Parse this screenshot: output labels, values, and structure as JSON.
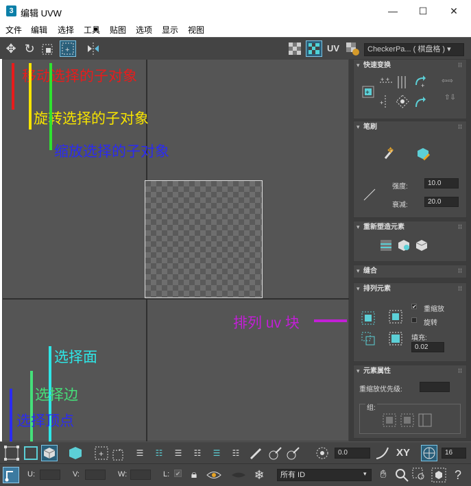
{
  "window": {
    "title": "编辑 UVW",
    "app_icon": "3",
    "minimize": "—",
    "maximize": "☐",
    "close": "✕"
  },
  "menu": [
    "文件",
    "编辑",
    "选择",
    "工具",
    "贴图",
    "选项",
    "显示",
    "视图"
  ],
  "toolbar": {
    "uv_label": "UV",
    "checker_dropdown": "CheckerPa... ( 棋盘格 )  ▾"
  },
  "annotations": {
    "move": "移动选择的子对象",
    "rotate": "旋转选择的子对象",
    "scale": "缩放选择的子对象",
    "arrange": "排列 uv 块",
    "select_face": "选择面",
    "select_edge": "选择边",
    "select_vertex": "选择顶点"
  },
  "colors": {
    "red": "#e81c1c",
    "yellow": "#f7e400",
    "green": "#2fe22f",
    "blue": "#2b2bf0",
    "magenta": "#c21fd6",
    "cyan": "#2ee7e7",
    "lime": "#45e07a"
  },
  "panel": {
    "quick_transform": {
      "title": "快速变换"
    },
    "brush": {
      "title": "笔刷",
      "strength_label": "强度:",
      "strength_value": "10.0",
      "falloff_label": "衰减:",
      "falloff_value": "20.0"
    },
    "reshape": {
      "title": "重新塑造元素"
    },
    "stitch": {
      "title": "缝合"
    },
    "arrange": {
      "title": "排列元素",
      "rescale_label": "重缩放",
      "rescale_checked": true,
      "rotate_label": "旋转",
      "rotate_checked": false,
      "padding_label": "填充:",
      "padding_value": "0.02"
    },
    "element_props": {
      "title": "元素属性",
      "rescale_priority_label": "重缩放优先级:",
      "group_label": "组:"
    }
  },
  "bottom1": {
    "angle_value": "0.0",
    "xy_label": "XY",
    "zoom_value": "16"
  },
  "bottom2": {
    "u_label": "U:",
    "v_label": "V:",
    "w_label": "W:",
    "l_label": "L:",
    "id_dropdown": "所有 ID"
  }
}
